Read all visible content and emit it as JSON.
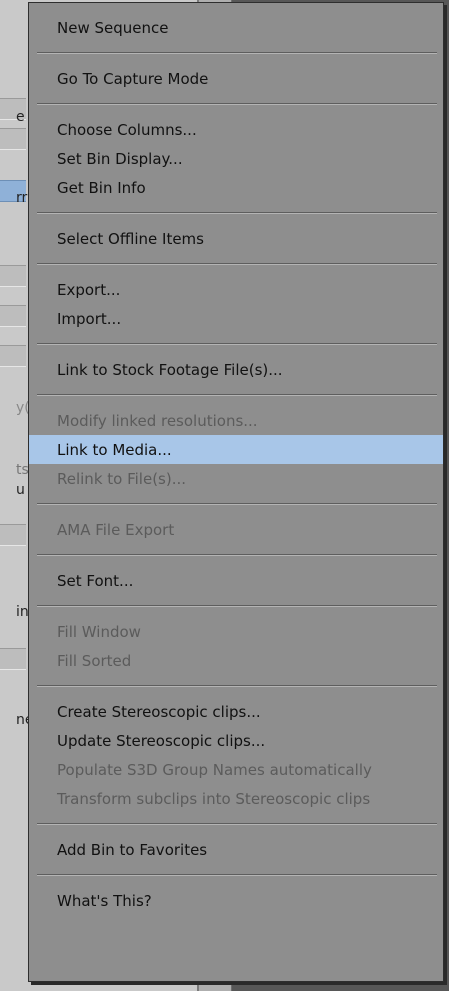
{
  "background": {
    "fragments": [
      "e",
      "rr",
      "y(",
      "ts",
      "u",
      "in",
      "ne"
    ]
  },
  "menu": {
    "groups": [
      [
        {
          "label": "New Sequence",
          "enabled": true
        }
      ],
      [
        {
          "label": "Go To Capture Mode",
          "enabled": true
        }
      ],
      [
        {
          "label": "Choose Columns...",
          "enabled": true
        },
        {
          "label": "Set Bin Display...",
          "enabled": true
        },
        {
          "label": "Get Bin Info",
          "enabled": true
        }
      ],
      [
        {
          "label": "Select Offline Items",
          "enabled": true
        }
      ],
      [
        {
          "label": "Export...",
          "enabled": true
        },
        {
          "label": "Import...",
          "enabled": true
        }
      ],
      [
        {
          "label": "Link to Stock Footage File(s)...",
          "enabled": true
        }
      ],
      [
        {
          "label": "Modify linked resolutions...",
          "enabled": false
        },
        {
          "label": "Link to Media...",
          "enabled": true,
          "highlighted": true
        },
        {
          "label": "Relink to File(s)...",
          "enabled": false
        }
      ],
      [
        {
          "label": "AMA File Export",
          "enabled": false
        }
      ],
      [
        {
          "label": "Set Font...",
          "enabled": true
        }
      ],
      [
        {
          "label": "Fill Window",
          "enabled": false
        },
        {
          "label": "Fill Sorted",
          "enabled": false
        }
      ],
      [
        {
          "label": "Create Stereoscopic clips...",
          "enabled": true
        },
        {
          "label": "Update Stereoscopic clips...",
          "enabled": true
        },
        {
          "label": "Populate S3D Group Names automatically",
          "enabled": false
        },
        {
          "label": "Transform subclips into Stereoscopic clips",
          "enabled": false
        }
      ],
      [
        {
          "label": "Add Bin to Favorites",
          "enabled": true
        }
      ],
      [
        {
          "label": "What's This?",
          "enabled": true
        }
      ]
    ],
    "colors": {
      "background": "#8e8e8e",
      "highlight": "#a8c6e8",
      "text": "#111111",
      "disabled_text": "#5b5b5b"
    }
  }
}
